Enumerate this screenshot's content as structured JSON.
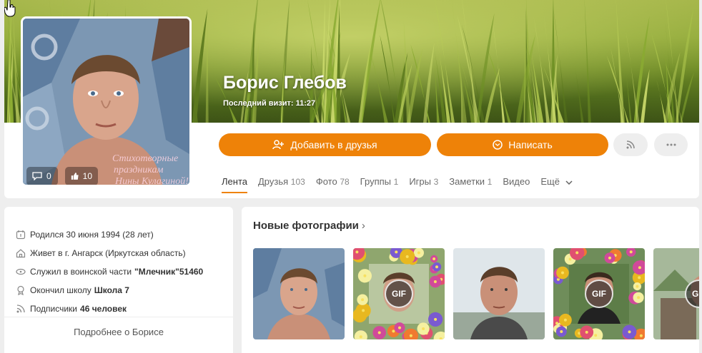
{
  "profile": {
    "name": "Борис Глебов",
    "last_visit": "Последний визит: 11:27",
    "avatar_comments": "0",
    "avatar_likes": "10",
    "avatar_watermark": [
      "Стихотворные",
      "праздникам",
      "Нины Кулагиной!"
    ]
  },
  "actions": {
    "add_friend": "Добавить в друзья",
    "message": "Написать"
  },
  "tabs": [
    {
      "label": "Лента",
      "count": "",
      "active": true
    },
    {
      "label": "Друзья",
      "count": "103"
    },
    {
      "label": "Фото",
      "count": "78"
    },
    {
      "label": "Группы",
      "count": "1"
    },
    {
      "label": "Игры",
      "count": "3"
    },
    {
      "label": "Заметки",
      "count": "1"
    },
    {
      "label": "Видео",
      "count": ""
    },
    {
      "label": "Ещё",
      "count": ""
    }
  ],
  "info": {
    "born": "Родился 30 июня 1994 (28 лет)",
    "lives": "Живет в г. Ангарск (Иркутская область)",
    "served_prefix": "Служил в воинской части",
    "served_bold": "\"Млечник\"51460",
    "school_prefix": "Окончил школу",
    "school_bold": "Школа 7",
    "subs_prefix": "Подписчики",
    "subs_bold": "46 человек",
    "more": "Подробнее о Борисе"
  },
  "photos": {
    "title": "Новые фотографии",
    "gif_label": "GIF"
  },
  "colors": {
    "accent": "#ee8208",
    "background": "#eeeeee"
  }
}
